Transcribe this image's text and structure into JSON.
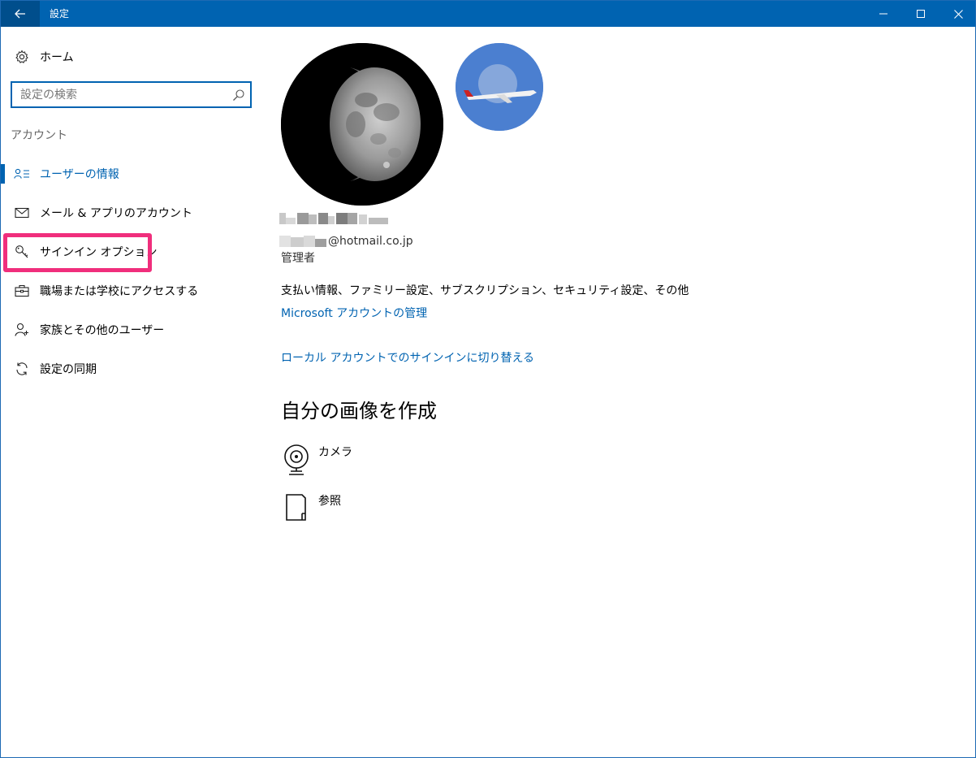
{
  "window": {
    "title": "設定"
  },
  "sidebar": {
    "home_label": "ホーム",
    "search_placeholder": "設定の検索",
    "section_label": "アカウント",
    "items": [
      {
        "label": "ユーザーの情報",
        "icon": "user-info-icon",
        "selected": true
      },
      {
        "label": "メール & アプリのアカウント",
        "icon": "mail-icon",
        "selected": false
      },
      {
        "label": "サインイン オプション",
        "icon": "key-icon",
        "selected": false,
        "highlighted": true
      },
      {
        "label": "職場または学校にアクセスする",
        "icon": "briefcase-icon",
        "selected": false
      },
      {
        "label": "家族とその他のユーザー",
        "icon": "add-user-icon",
        "selected": false
      },
      {
        "label": "設定の同期",
        "icon": "sync-icon",
        "selected": false
      }
    ]
  },
  "main": {
    "email_domain": "@hotmail.co.jp",
    "role": "管理者",
    "billing_info": "支払い情報、ファミリー設定、サブスクリプション、セキュリティ設定、その他",
    "manage_link": "Microsoft アカウントの管理",
    "local_link": "ローカル アカウントでのサインインに切り替える",
    "create_heading": "自分の画像を作成",
    "actions": [
      {
        "label": "カメラ",
        "icon": "webcam-icon"
      },
      {
        "label": "参照",
        "icon": "browse-file-icon"
      }
    ]
  },
  "colors": {
    "accent": "#0063b1",
    "highlight": "#f02e7c",
    "titlebar": "#0063b1"
  }
}
